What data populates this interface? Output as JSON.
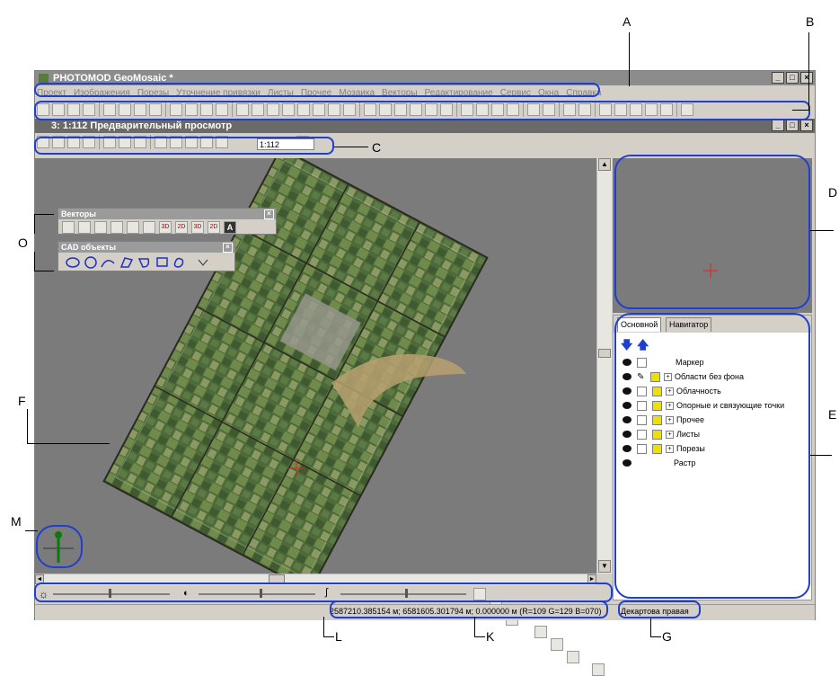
{
  "app": {
    "title": "PHOTOMOD GeoMosaic *",
    "window_controls": [
      "_",
      "□",
      "×"
    ]
  },
  "menu": [
    "Проект",
    "Изображения",
    "Порезы",
    "Уточнение привязки",
    "Листы",
    "Прочее",
    "Мозаика",
    "Векторы",
    "Редактирование",
    "Сервис",
    "Окна",
    "Справка"
  ],
  "subwindow": {
    "title": "3: 1:112 Предварительный просмотр",
    "scale_value": "1:112"
  },
  "panels": {
    "vectors_title": "Векторы",
    "cad_title": "CAD объекты",
    "vector_tool_labels": [
      "3D",
      "2D",
      "3D",
      "2D"
    ],
    "text_tool": "A"
  },
  "layers": {
    "tabs": [
      "Основной",
      "Навигатор"
    ],
    "items": [
      {
        "label": "Маркер",
        "yellow": false,
        "expand": false,
        "checkbox": true
      },
      {
        "label": "Области без фона",
        "yellow": true,
        "expand": true,
        "checkbox": false
      },
      {
        "label": "Облачность",
        "yellow": true,
        "expand": true,
        "checkbox": true
      },
      {
        "label": "Опорные и связующие точки",
        "yellow": true,
        "expand": true,
        "checkbox": true
      },
      {
        "label": "Прочее",
        "yellow": true,
        "expand": true,
        "checkbox": true
      },
      {
        "label": "Листы",
        "yellow": true,
        "expand": true,
        "checkbox": true
      },
      {
        "label": "Порезы",
        "yellow": true,
        "expand": true,
        "checkbox": true
      },
      {
        "label": "Растр",
        "yellow": false,
        "expand": false,
        "checkbox": false
      }
    ]
  },
  "status": {
    "coords": "2587210.385154 м; 6581605.301794 м; 0.000000 м   (R=109 G=129 B=070)",
    "system": "Декартова правая"
  },
  "callouts": {
    "A": "A",
    "B": "B",
    "C": "C",
    "D": "D",
    "E": "E",
    "F": "F",
    "G": "G",
    "K": "K",
    "L": "L",
    "M": "M",
    "O": "O"
  },
  "colors": {
    "highlight": "#1f3fd0",
    "canvas": "#7b7b7b",
    "yellow_box": "#f0e000"
  }
}
